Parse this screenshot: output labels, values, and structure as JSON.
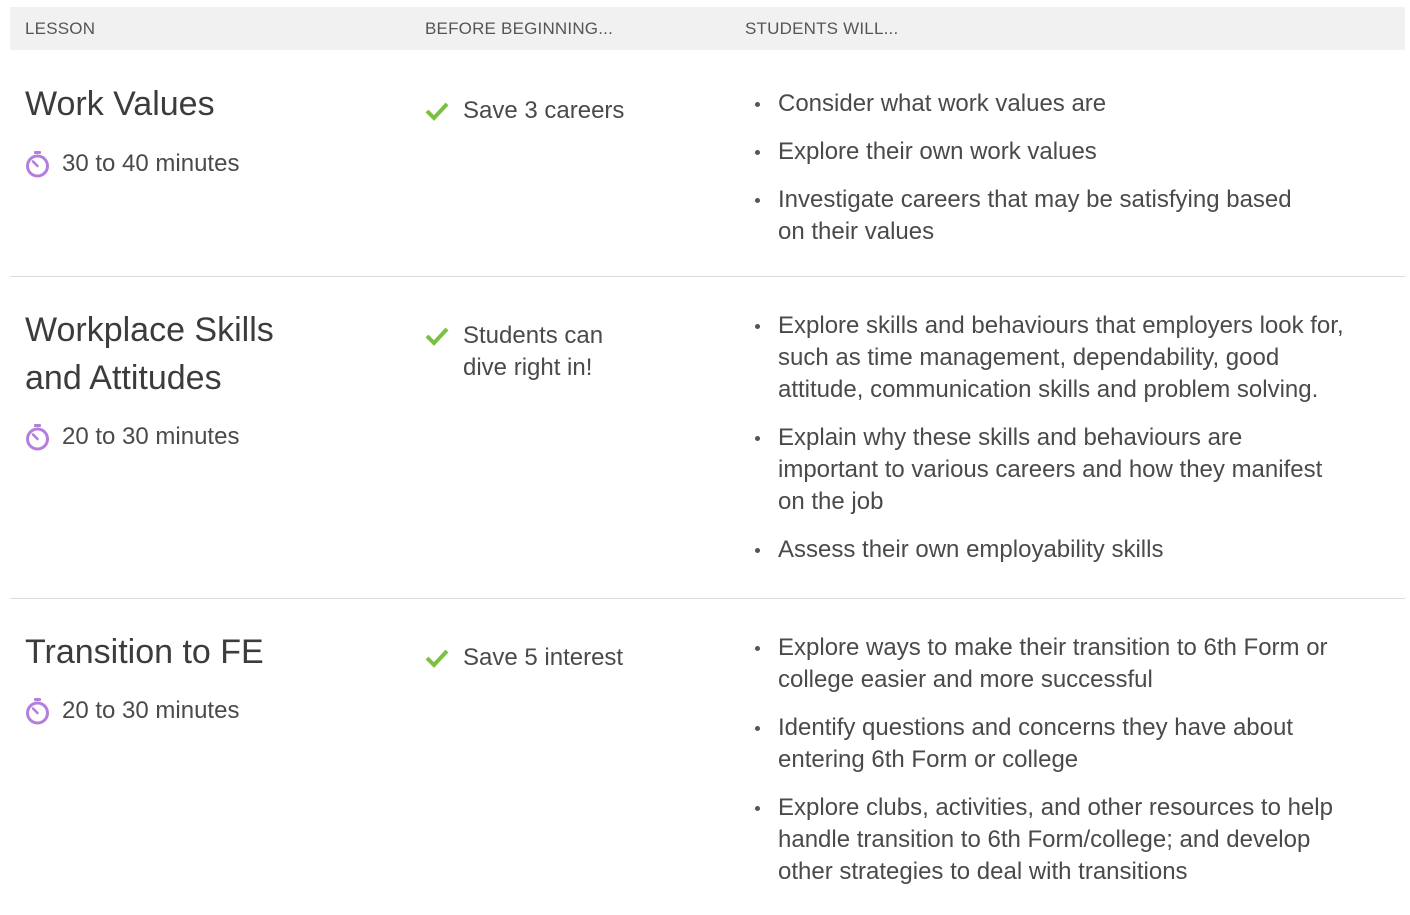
{
  "header": {
    "lesson": "LESSON",
    "before": "BEFORE BEGINNING...",
    "students": "STUDENTS WILL..."
  },
  "colors": {
    "timer_icon": "#b57edc",
    "check_icon": "#7ac143",
    "header_bg": "#f1f1f1"
  },
  "lessons": [
    {
      "title_lines": [
        "Work Values"
      ],
      "duration": "30 to 40 minutes",
      "prereq_lines": [
        "Save 3 careers"
      ],
      "outcomes": [
        [
          "Consider what work values are"
        ],
        [
          "Explore their own work values"
        ],
        [
          "Investigate careers that may be satisfying based",
          "on their values"
        ]
      ]
    },
    {
      "title_lines": [
        "Workplace Skills",
        "and Attitudes"
      ],
      "duration": "20 to 30 minutes",
      "prereq_lines": [
        "Students can",
        "dive right in!"
      ],
      "outcomes": [
        [
          "Explore skills and behaviours that employers look for,",
          "such as time management, dependability, good",
          "attitude, communication skills and problem solving."
        ],
        [
          "Explain why these skills and behaviours are",
          "important to various careers and how they manifest",
          "on the job"
        ],
        [
          "Assess their own employability skills"
        ]
      ]
    },
    {
      "title_lines": [
        "Transition to FE"
      ],
      "duration": "20 to 30 minutes",
      "prereq_lines": [
        "Save 5 interest"
      ],
      "outcomes": [
        [
          "Explore ways to make their transition to 6th Form or",
          "college easier and more successful"
        ],
        [
          "Identify questions and concerns they have about",
          "entering 6th Form or college"
        ],
        [
          "Explore clubs, activities, and other resources to help",
          "handle transition to 6th Form/college; and develop",
          "other strategies to deal with transitions"
        ]
      ]
    }
  ]
}
